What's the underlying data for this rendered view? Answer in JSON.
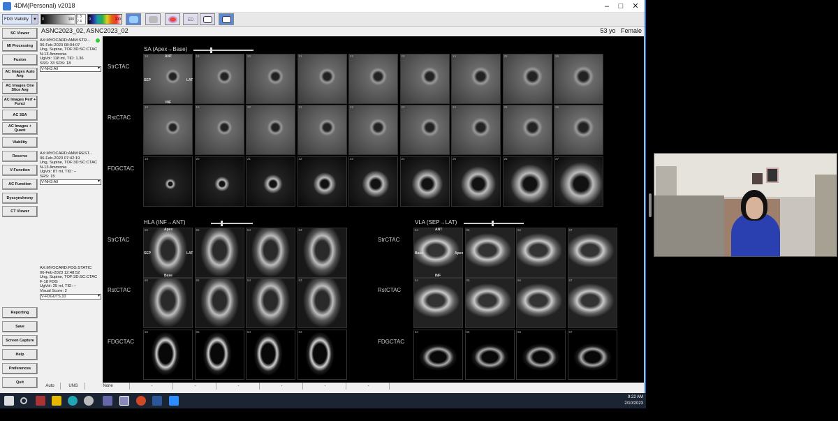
{
  "window": {
    "title": "4DM(Personal) v2018"
  },
  "toolbar": {
    "mode_select": "FDG Viability",
    "colorbar1": {
      "min": "0",
      "max": "100"
    },
    "colorbar2": {
      "min": "0",
      "max": "100"
    },
    "small_nums": [
      "1",
      "3",
      "2",
      "4"
    ],
    "ed_label": "ED"
  },
  "header": {
    "patient": "ASNC2023_02, ASNC2023_02",
    "age": "53 yo",
    "sex": "Female"
  },
  "nav": {
    "top": [
      "SC Viewer",
      "MI Processing",
      "Fusion",
      "AC Images Auto Avg",
      "AC Images One Slice Avg",
      "AC Images Perf + Funct",
      "AC 3SA",
      "AC Images + Quant",
      "Viability",
      "Reserve",
      "V-Function",
      "AC Function",
      "Dyssynchrony",
      "CT Viewer"
    ],
    "bottom": [
      "Reporting",
      "Save",
      "Screen Capture",
      "Help",
      "Preferences",
      "Quit"
    ]
  },
  "studies": [
    {
      "lines": [
        "AX:MYOCARD:AMM:STR...",
        "06-Feb-2023 08:04:07",
        "Ung, Supine, TOF:3D:SC:CTAC",
        "N-13 Ammonia",
        "UgVol: 118 ml, TID: 1.36",
        "SSS: 33   SDS: 18"
      ],
      "select": "V-NH3:All"
    },
    {
      "lines": [
        "AX:MYOCARD:AMM:REST...",
        "06-Feb-2023 07:42:19",
        "Ung, Supine, TOF:3D:SC:CTAC",
        "N-13 Ammonia",
        "UgVol: 87 ml, TID: --",
        "SRS: 15"
      ],
      "select": "V-NH3:All"
    },
    {
      "lines": [
        "AX:MYOCARD:FDG:STATIC",
        "06-Feb-2023 12:48:52",
        "Ung, Supine, TOF:3D:SC:CTAC",
        "F-18 FDG",
        "UgVol: 25 ml, TID: --",
        "Visual Score: 2"
      ],
      "select": "V-FDGUTS,10"
    }
  ],
  "sa": {
    "title": "SA (Apex→Base)",
    "rows": [
      {
        "label": "StrCTAC",
        "nums": [
          "18",
          "19",
          "20",
          "21",
          "22",
          "23",
          "24",
          "25",
          "26"
        ]
      },
      {
        "label": "RstCTAC",
        "nums": [
          "18",
          "19",
          "20",
          "21",
          "22",
          "23",
          "24",
          "25",
          "26"
        ]
      },
      {
        "label": "FDGCTAC",
        "nums": [
          "19",
          "20",
          "21",
          "22",
          "23",
          "24",
          "25",
          "26",
          "27"
        ]
      }
    ],
    "ann": {
      "ant": "ANT",
      "sep": "SEP",
      "lat": "LAT",
      "inf": "INF"
    }
  },
  "hla": {
    "title": "HLA (INF→ANT)",
    "rows": [
      {
        "label": "StrCTAC",
        "nums": [
          "66",
          "65",
          "64",
          "63"
        ]
      },
      {
        "label": "RstCTAC",
        "nums": [
          "66",
          "65",
          "64",
          "63"
        ]
      },
      {
        "label": "FDGCTAC",
        "nums": [
          "66",
          "65",
          "64",
          "63"
        ]
      }
    ],
    "ann": {
      "apex": "Apex",
      "sep": "SEP",
      "lat": "LAT",
      "base": "Base"
    }
  },
  "vla": {
    "title": "VLA (SEP→LAT)",
    "rows": [
      {
        "label": "StrCTAC",
        "nums": [
          "64",
          "65",
          "66",
          "67"
        ]
      },
      {
        "label": "RstCTAC",
        "nums": [
          "64",
          "65",
          "66",
          "67"
        ]
      },
      {
        "label": "FDGCTAC",
        "nums": [
          "64",
          "65",
          "66",
          "67"
        ]
      }
    ],
    "ann": {
      "ant": "ANT",
      "base": "Base",
      "apex": "Apex",
      "inf": "INF"
    }
  },
  "status": [
    "Auto",
    "UNG",
    "None",
    "-",
    "-",
    "-",
    "-",
    "-",
    "-"
  ],
  "taskbar": {
    "time": "9:22 AM",
    "date": "2/10/2023"
  }
}
